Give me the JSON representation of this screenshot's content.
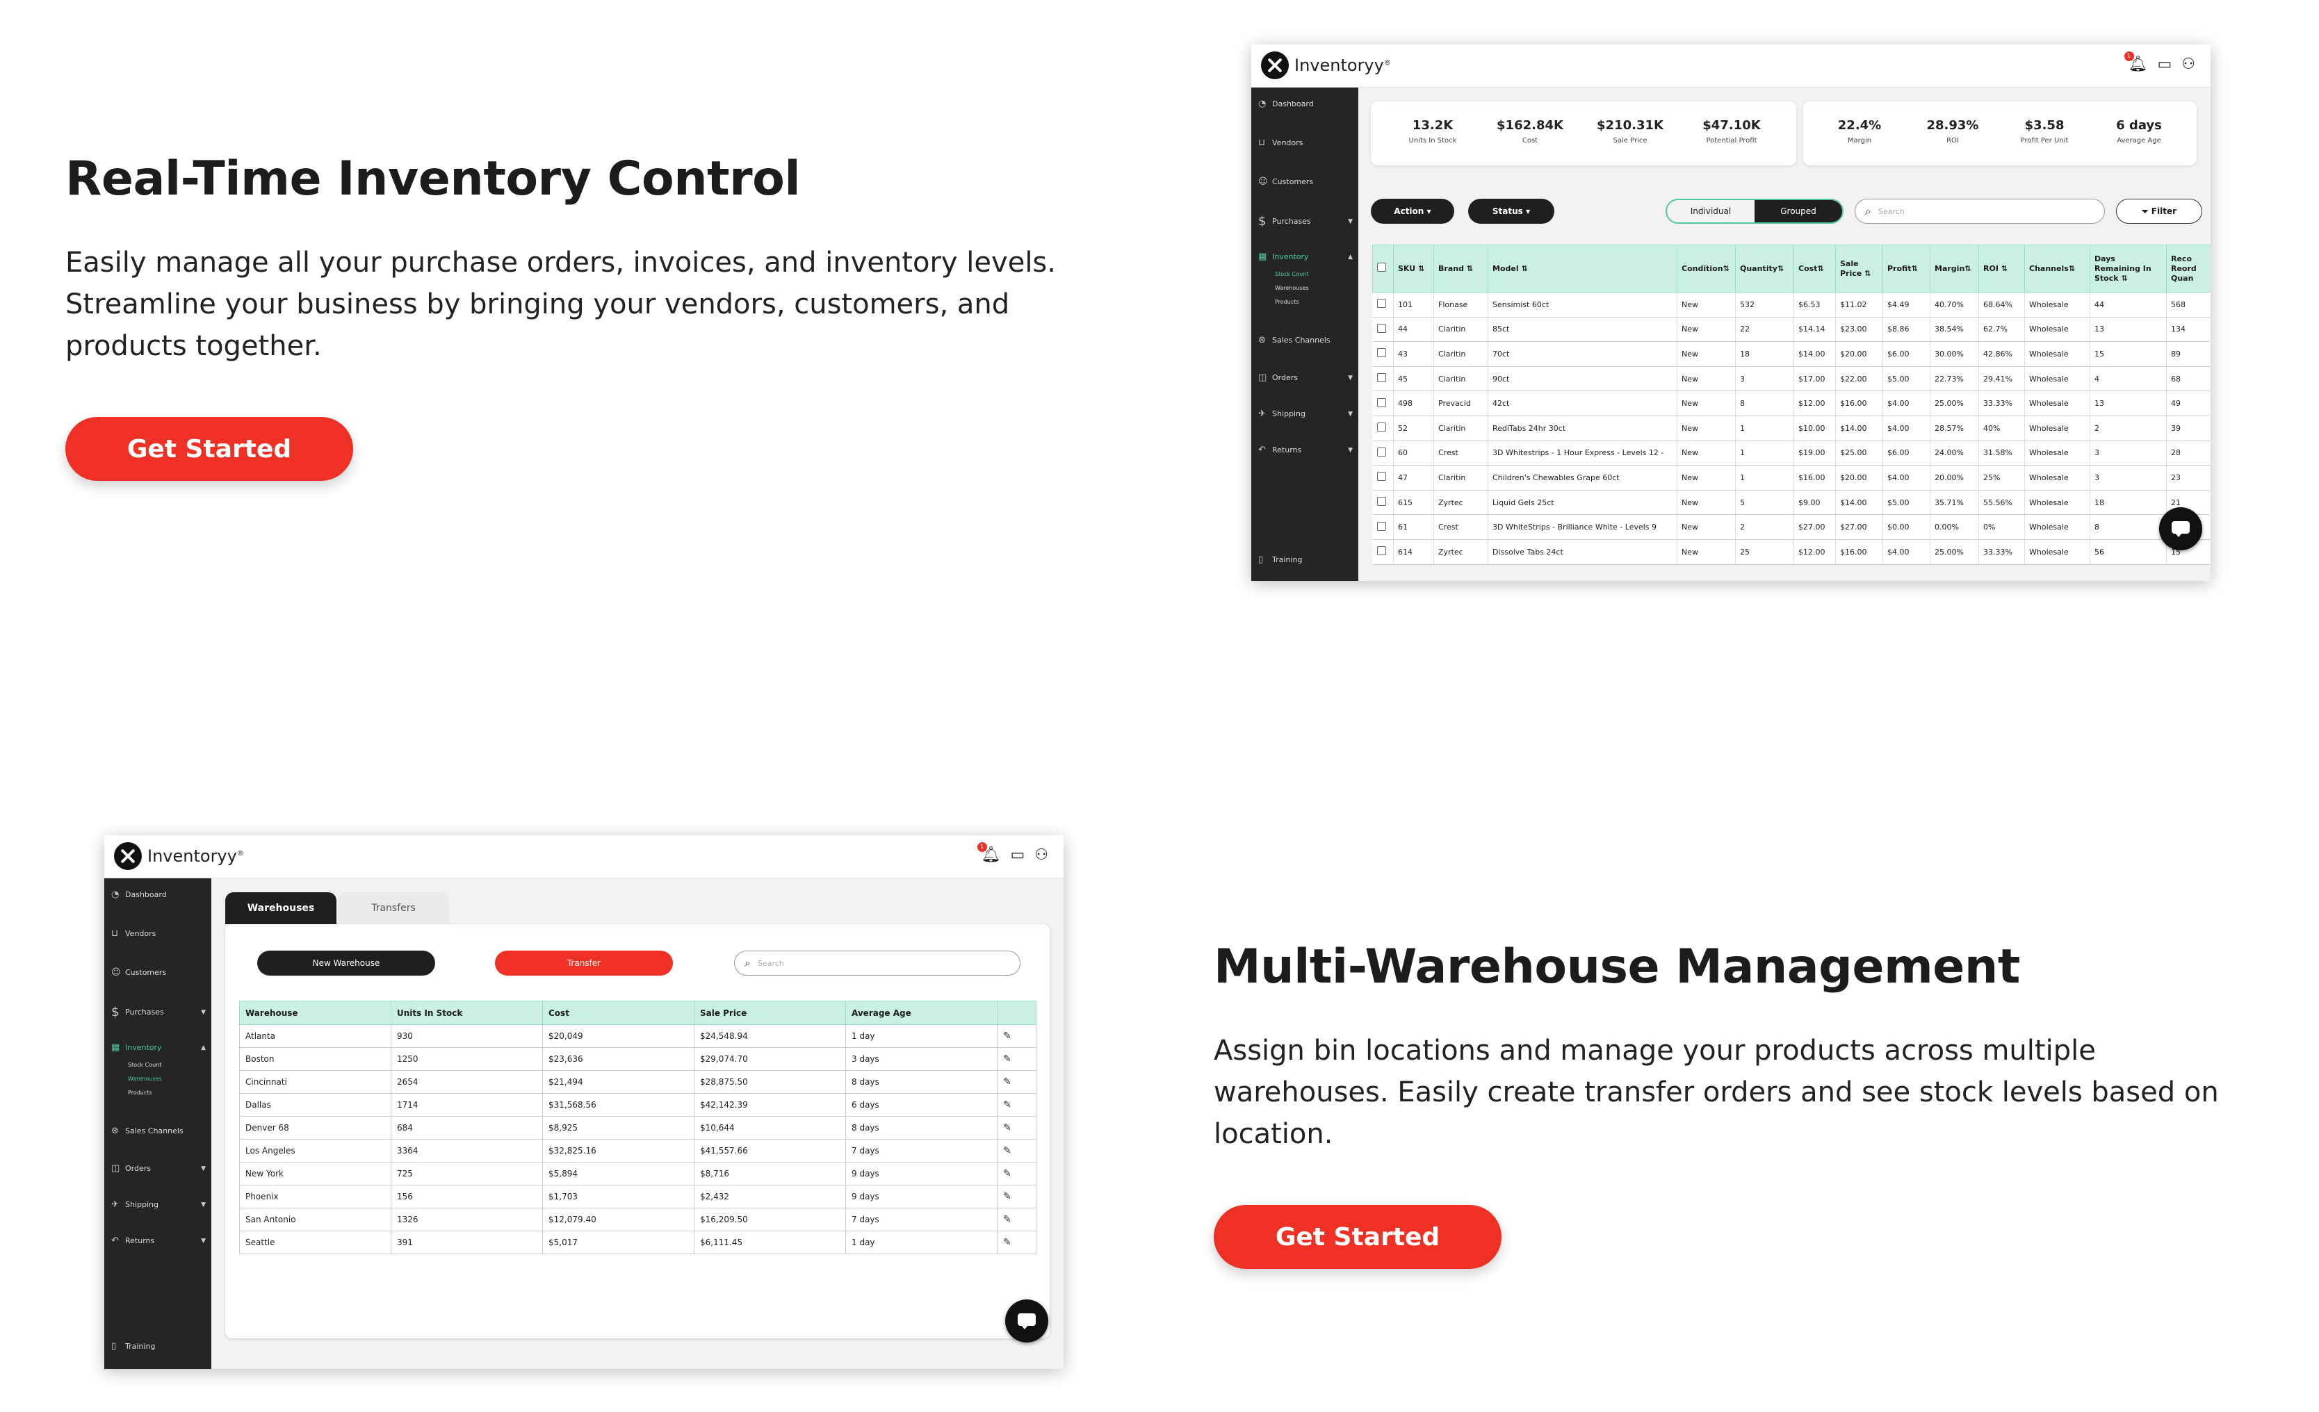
{
  "section1": {
    "title": "Real-Time Inventory Control",
    "desc_lines": [
      "Easily manage all your purchase orders, invoices, and inventory levels.",
      "Streamline your business by bringing your vendors, customers, and",
      "products together."
    ],
    "cta": "Get Started"
  },
  "section2": {
    "title": "Multi-Warehouse Management",
    "desc_lines": [
      "Assign bin locations and manage your products across multiple",
      "warehouses. Easily create transfer orders and see stock levels based on",
      "location."
    ],
    "cta": "Get Started"
  },
  "app": {
    "logo": "Inventoryy",
    "logo_mark": "®",
    "notif_count": "1",
    "sidebar": {
      "dashboard": "Dashboard",
      "vendors": "Vendors",
      "customers": "Customers",
      "purchases": "Purchases",
      "inventory": "Inventory",
      "stock_count": "Stock Count",
      "warehouses": "Warehouses",
      "products": "Products",
      "sales_channels": "Sales Channels",
      "orders": "Orders",
      "shipping": "Shipping",
      "returns": "Returns",
      "training": "Training"
    }
  },
  "inventory_screen": {
    "stats_left": [
      {
        "value": "13.2K",
        "label": "Units In Stock"
      },
      {
        "value": "$162.84K",
        "label": "Cost"
      },
      {
        "value": "$210.31K",
        "label": "Sale Price"
      },
      {
        "value": "$47.10K",
        "label": "Potential Profit"
      }
    ],
    "stats_right": [
      {
        "value": "22.4%",
        "label": "Margin"
      },
      {
        "value": "28.93%",
        "label": "ROI"
      },
      {
        "value": "$3.58",
        "label": "Profit Per Unit"
      },
      {
        "value": "6 days",
        "label": "Average Age"
      }
    ],
    "action_label": "Action",
    "status_label": "Status",
    "seg_individual": "Individual",
    "seg_grouped": "Grouped",
    "search_placeholder": "Search",
    "filter_label": "Filter",
    "columns": [
      "SKU ⇅",
      "Brand ⇅",
      "Model ⇅",
      "Condition⇅",
      "Quantity⇅",
      "Cost⇅",
      "Sale Price ⇅",
      "Profit⇅",
      "Margin⇅",
      "ROI ⇅",
      "Channels⇅",
      "Days Remaining In Stock ⇅",
      "Reco Reord Quan"
    ],
    "rows": [
      [
        "101",
        "Flonase",
        "Sensimist 60ct",
        "New",
        "532",
        "$6.53",
        "$11.02",
        "$4.49",
        "40.70%",
        "68.64%",
        "Wholesale",
        "44",
        "568"
      ],
      [
        "44",
        "Claritin",
        "85ct",
        "New",
        "22",
        "$14.14",
        "$23.00",
        "$8.86",
        "38.54%",
        "62.7%",
        "Wholesale",
        "13",
        "134"
      ],
      [
        "43",
        "Claritin",
        "70ct",
        "New",
        "18",
        "$14.00",
        "$20.00",
        "$6.00",
        "30.00%",
        "42.86%",
        "Wholesale",
        "15",
        "89"
      ],
      [
        "45",
        "Claritin",
        "90ct",
        "New",
        "3",
        "$17.00",
        "$22.00",
        "$5.00",
        "22.73%",
        "29.41%",
        "Wholesale",
        "4",
        "68"
      ],
      [
        "498",
        "Prevacid",
        "42ct",
        "New",
        "8",
        "$12.00",
        "$16.00",
        "$4.00",
        "25.00%",
        "33.33%",
        "Wholesale",
        "13",
        "49"
      ],
      [
        "52",
        "Claritin",
        "RediTabs 24hr 30ct",
        "New",
        "1",
        "$10.00",
        "$14.00",
        "$4.00",
        "28.57%",
        "40%",
        "Wholesale",
        "2",
        "39"
      ],
      [
        "60",
        "Crest",
        "3D Whitestrips - 1 Hour Express - Levels 12 -",
        "New",
        "1",
        "$19.00",
        "$25.00",
        "$6.00",
        "24.00%",
        "31.58%",
        "Wholesale",
        "3",
        "28"
      ],
      [
        "47",
        "Claritin",
        "Children's Chewables Grape 60ct",
        "New",
        "1",
        "$16.00",
        "$20.00",
        "$4.00",
        "20.00%",
        "25%",
        "Wholesale",
        "3",
        "23"
      ],
      [
        "615",
        "Zyrtec",
        "Liquid Gels 25ct",
        "New",
        "5",
        "$9.00",
        "$14.00",
        "$5.00",
        "35.71%",
        "55.56%",
        "Wholesale",
        "18",
        "21"
      ],
      [
        "61",
        "Crest",
        "3D WhiteStrips - Brilliance White - Levels 9",
        "New",
        "2",
        "$27.00",
        "$27.00",
        "$0.00",
        "0.00%",
        "0%",
        "Wholesale",
        "8",
        "17"
      ],
      [
        "614",
        "Zyrtec",
        "Dissolve Tabs 24ct",
        "New",
        "25",
        "$12.00",
        "$16.00",
        "$4.00",
        "25.00%",
        "33.33%",
        "Wholesale",
        "56",
        "15"
      ]
    ]
  },
  "warehouse_screen": {
    "tab_warehouses": "Warehouses",
    "tab_transfers": "Transfers",
    "new_warehouse": "New Warehouse",
    "transfer": "Transfer",
    "search_placeholder": "Search",
    "columns": [
      "Warehouse",
      "Units In Stock",
      "Cost",
      "Sale Price",
      "Average Age",
      ""
    ],
    "rows": [
      [
        "Atlanta",
        "930",
        "$20,049",
        "$24,548.94",
        "1 day"
      ],
      [
        "Boston",
        "1250",
        "$23,636",
        "$29,074.70",
        "3 days"
      ],
      [
        "Cincinnati",
        "2654",
        "$21,494",
        "$28,875.50",
        "8 days"
      ],
      [
        "Dallas",
        "1714",
        "$31,568.56",
        "$42,142.39",
        "6 days"
      ],
      [
        "Denver 68",
        "684",
        "$8,925",
        "$10,644",
        "8 days"
      ],
      [
        "Los Angeles",
        "3364",
        "$32,825.16",
        "$41,557.66",
        "7 days"
      ],
      [
        "New York",
        "725",
        "$5,894",
        "$8,716",
        "9 days"
      ],
      [
        "Phoenix",
        "156",
        "$1,703",
        "$2,432",
        "9 days"
      ],
      [
        "San Antonio",
        "1326",
        "$12,079.40",
        "$16,209.50",
        "7 days"
      ],
      [
        "Seattle",
        "391",
        "$5,017",
        "$6,111.45",
        "1 day"
      ]
    ]
  },
  "colors": {
    "accent": "#ee3124",
    "mint": "#c9f0e3",
    "green": "#4fc99a",
    "sidebar": "#252525"
  }
}
